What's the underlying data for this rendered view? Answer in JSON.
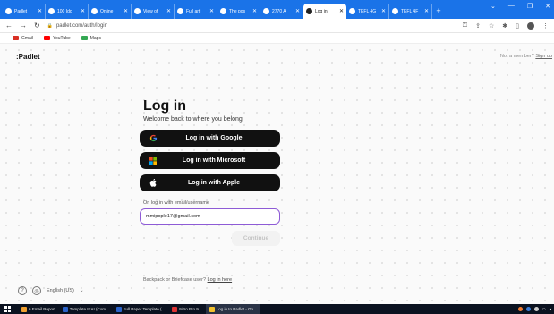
{
  "browser": {
    "tabs": [
      {
        "title": "Padlet",
        "active": false
      },
      {
        "title": "100 Ido",
        "active": false
      },
      {
        "title": "Online",
        "active": false
      },
      {
        "title": "View of",
        "active": false
      },
      {
        "title": "Full arti",
        "active": false
      },
      {
        "title": "The pos",
        "active": false
      },
      {
        "title": "2770 A",
        "active": false
      },
      {
        "title": "Log in",
        "active": true
      },
      {
        "title": "TEFL 4G",
        "active": false
      },
      {
        "title": "TEFL 4F",
        "active": false
      }
    ],
    "new_tab": "+",
    "url": "padlet.com/auth/login",
    "bookmarks": [
      {
        "label": "Gmail",
        "color": "#d93025"
      },
      {
        "label": "YouTube",
        "color": "#ff0000"
      },
      {
        "label": "Maps",
        "color": "#34a853"
      }
    ]
  },
  "header": {
    "logo": ":Padlet",
    "signup_prompt": "Not a member?",
    "signup_link": "Sign up"
  },
  "login": {
    "title": "Log in",
    "subtitle": "Welcome back to where you belong",
    "google_label": "Log in with Google",
    "microsoft_label": "Log in with Microsoft",
    "apple_label": "Log in with Apple",
    "or_text": "Or, log in with email/username",
    "email_value": "mmipople17@gmail.com",
    "continue_label": "Continue",
    "backpack_text": "Backpack or Briefcase user?",
    "backpack_link": "Log in here"
  },
  "footer": {
    "language": "English (US)"
  },
  "taskbar": {
    "items": [
      {
        "label": "6 Email Report",
        "color": "#f0a030",
        "active": false
      },
      {
        "label": "Template IEAI (Com...",
        "color": "#2b63c9",
        "active": false
      },
      {
        "label": "Full Paper Template (...",
        "color": "#2b63c9",
        "active": false
      },
      {
        "label": "Nitro Pro 9",
        "color": "#d33",
        "active": false
      },
      {
        "label": "Log in to Padlet - Go...",
        "color": "#f2c12e",
        "active": true
      }
    ]
  },
  "colors": {
    "browser_accent": "#1a73e8",
    "button_dark": "#111111",
    "input_focus": "#8e5bd6"
  }
}
